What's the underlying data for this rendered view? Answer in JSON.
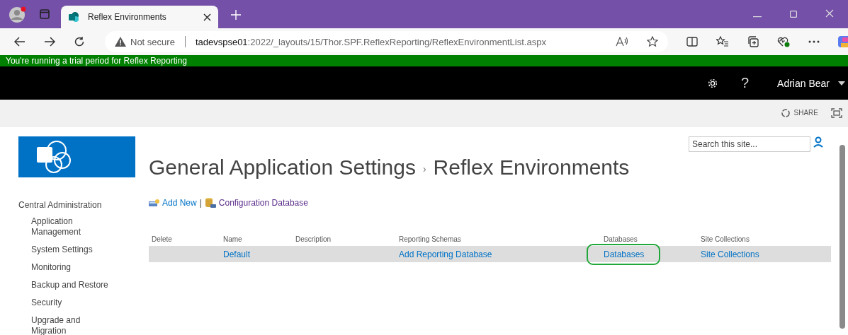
{
  "browser": {
    "tab_title": "Reflex Environments",
    "security": "Not secure",
    "url_host": "tadevspse01",
    "url_path": ":2022/_layouts/15/Thor.SPF.ReflexReporting/ReflexEnvironmentList.aspx"
  },
  "trial_banner": "You're running a trial period for Reflex Reporting",
  "suite_bar": {
    "help": "?",
    "user": "Adrian Bear"
  },
  "ribbon": {
    "share": "SHARE"
  },
  "search": {
    "placeholder": "Search this site..."
  },
  "title": {
    "parent": "General Application Settings",
    "separator": "›",
    "current": "Reflex Environments"
  },
  "quick_launch": {
    "heading": "Central Administration",
    "items": [
      {
        "label": "Application Management"
      },
      {
        "label": "System Settings"
      },
      {
        "label": "Monitoring"
      },
      {
        "label": "Backup and Restore"
      },
      {
        "label": "Security"
      },
      {
        "label": "Upgrade and Migration"
      }
    ]
  },
  "toolbar": {
    "add_new": "Add New",
    "separator": "|",
    "config": "Configuration Database"
  },
  "table": {
    "columns": [
      "Delete",
      "Name",
      "Description",
      "Reporting Schemas",
      "Databases",
      "Site Collections"
    ],
    "rows": [
      {
        "cells": [
          {
            "text": "",
            "highlighted": false
          },
          {
            "text": "Default",
            "highlighted": false
          },
          {
            "text": "",
            "highlighted": false
          },
          {
            "text": "Add Reporting Database",
            "highlighted": false
          },
          {
            "text": "Databases",
            "highlighted": true
          },
          {
            "text": "Site Collections",
            "highlighted": false
          }
        ]
      }
    ]
  }
}
